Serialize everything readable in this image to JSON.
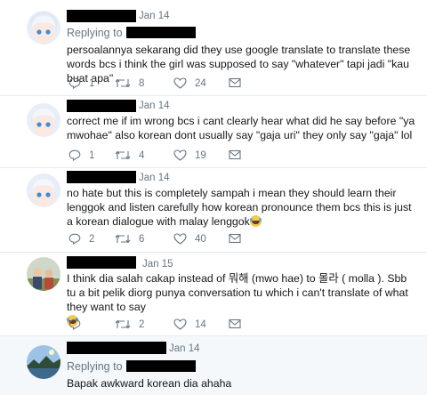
{
  "tweets": [
    {
      "date": "Jan 14",
      "replying_label": "Replying to",
      "text": "persoalannya sekarang did they use google translate to translate these words bcs i think the girl was supposed to say \"whatever\" tapi jadi \"kau buat apa\"",
      "replies": "1",
      "retweets": "8",
      "likes": "24",
      "avatar": "anime-avatar"
    },
    {
      "date": "Jan 14",
      "text": "correct me if im wrong bcs i cant clearly hear what did he say before \"ya mwohae\" also korean dont usually say \"gaja uri\" they only say \"gaja\" lol",
      "replies": "1",
      "retweets": "4",
      "likes": "19",
      "avatar": "anime-avatar"
    },
    {
      "date": "Jan 14",
      "text": "no hate but this is completely sampah i mean they should learn their lenggok and listen carefully how korean pronounce them bcs this is just a korean dialogue with malay lenggok",
      "replies": "2",
      "retweets": "6",
      "likes": "40",
      "avatar": "anime-avatar"
    },
    {
      "date": "Jan 15",
      "text": "I think dia salah cakap instead of 뭐해 (mwo hae) to 몰라 ( molla ). Sbb tu a bit pelik diorg punya conversation tu which i can't translate of what they want to say",
      "replies": "",
      "retweets": "2",
      "likes": "14",
      "avatar": "photo-avatar"
    },
    {
      "date": "Jan 14",
      "replying_label": "Replying to",
      "text": "Bapak awkward korean dia ahaha",
      "avatar": "landscape-avatar"
    }
  ],
  "colors": {
    "text": "#14171a",
    "muted": "#657786",
    "divider": "#e6ecf0",
    "highlight_bg": "#f5f8fa"
  }
}
